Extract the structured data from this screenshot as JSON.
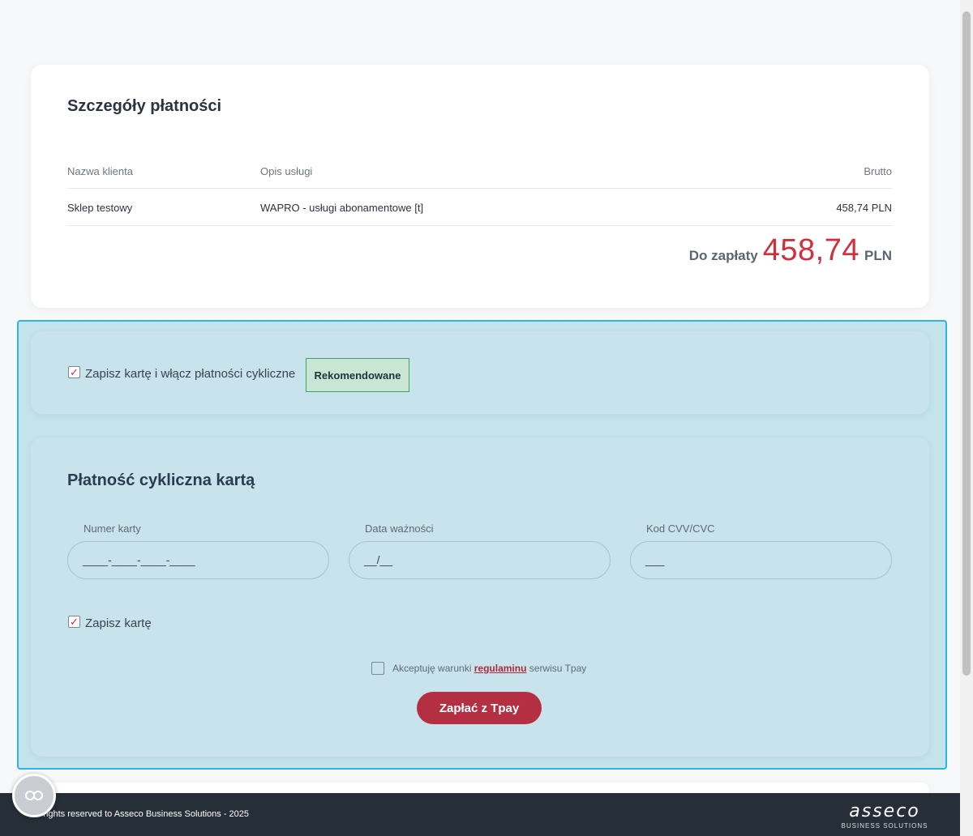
{
  "details": {
    "title": "Szczegóły płatności",
    "columns": {
      "client": "Nazwa klienta",
      "description": "Opis usługi",
      "gross": "Brutto"
    },
    "row": {
      "client": "Sklep testowy",
      "description": "WAPRO - usługi abonamentowe [t]",
      "gross": "458,74 PLN"
    },
    "total_label": "Do zapłaty",
    "total_amount": "458,74",
    "total_currency": "PLN"
  },
  "recurring": {
    "checkbox_label": "Zapisz kartę i włącz płatności cykliczne",
    "checked": true,
    "badge": "Rekomendowane"
  },
  "card_form": {
    "title": "Płatność cykliczna kartą",
    "card_number_label": "Numer karty",
    "card_number_placeholder": "____-____-____-____",
    "expiry_label": "Data ważności",
    "expiry_placeholder": "__/__",
    "cvv_label": "Kod CVV/CVC",
    "cvv_placeholder": "___",
    "save_card_label": "Zapisz kartę",
    "save_card_checked": true,
    "terms_prefix": "Akceptuję warunki",
    "terms_link": "regulaminu",
    "terms_suffix": "serwisu Tpay",
    "pay_button": "Zapłać z Tpay"
  },
  "footer": {
    "copyright": "All rights reserved to Asseco Business Solutions - 2025",
    "logo_word": "asseco",
    "logo_sub": "BUSINESS SOLUTIONS"
  },
  "colors": {
    "accent_red": "#d22f3c",
    "pay_button": "#b52f42",
    "highlight_border": "#2fb3e6",
    "footer_bg": "#262f38"
  },
  "icons": {
    "checkbox_checked": "check-icon",
    "cookie": "cookie-icon"
  }
}
